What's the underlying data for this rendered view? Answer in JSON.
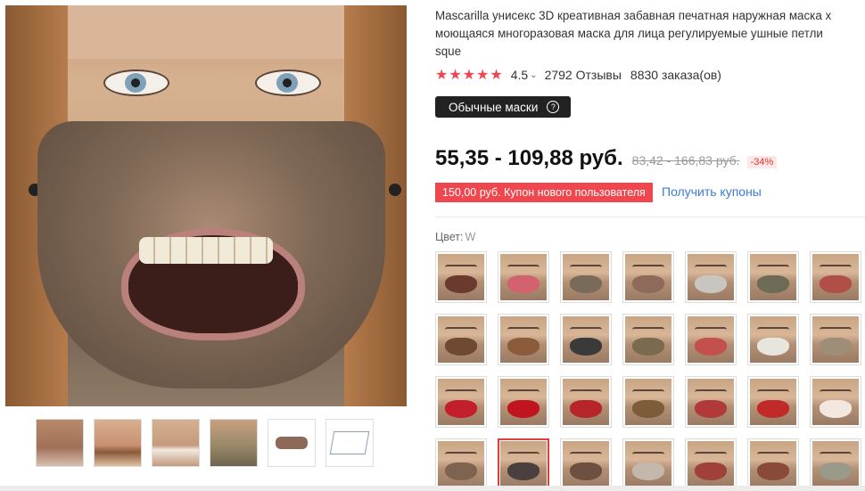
{
  "product": {
    "title_line1": "Mascarilla унисекс 3D креативная забавная печатная наружная маска x",
    "title_line2": "моющаяся многоразовая маска для лица регулируемые ушные петли",
    "title_line3": "sque"
  },
  "rating": {
    "stars": "★★★★★",
    "value": "4.5",
    "chevron": "⌄",
    "reviews": "2792 Отзывы",
    "orders": "8830 заказа(ов)"
  },
  "tag": {
    "label": "Обычные маски",
    "help": "?"
  },
  "price": {
    "current": "55,35 - 109,88 руб.",
    "old": "83,42 - 166,83 руб.",
    "discount": "-34%"
  },
  "coupon": {
    "label": "150,00 руб. Купон нового пользователя",
    "link": "Получить купоны"
  },
  "color": {
    "label": "Цвет:",
    "value": "W"
  },
  "swatches": [
    {
      "mouth": "#6b3a2e"
    },
    {
      "mouth": "#d2626e"
    },
    {
      "mouth": "#7a6a5a"
    },
    {
      "mouth": "#8e6a5a"
    },
    {
      "mouth": "#c9c6c0"
    },
    {
      "mouth": "#6d6a55"
    },
    {
      "mouth": "#b04e48"
    },
    {
      "mouth": "#6e4a33"
    },
    {
      "mouth": "#8b5c3c"
    },
    {
      "mouth": "#3a3a3a"
    },
    {
      "mouth": "#7a6a4e"
    },
    {
      "mouth": "#c4504e"
    },
    {
      "mouth": "#e8e4de"
    },
    {
      "mouth": "#9e8e78"
    },
    {
      "mouth": "#c21e2b"
    },
    {
      "mouth": "#c0141f"
    },
    {
      "mouth": "#b6252a"
    },
    {
      "mouth": "#7d5c3a"
    },
    {
      "mouth": "#b03a3a"
    },
    {
      "mouth": "#c22a2a"
    },
    {
      "mouth": "#f2e8e0"
    },
    {
      "mouth": "#7e6450"
    },
    {
      "mouth": "#4a4040"
    },
    {
      "mouth": "#6e5040"
    },
    {
      "mouth": "#c4b8ac"
    },
    {
      "mouth": "#a0403a"
    },
    {
      "mouth": "#8a4a3a"
    },
    {
      "mouth": "#9a9a8a"
    }
  ]
}
